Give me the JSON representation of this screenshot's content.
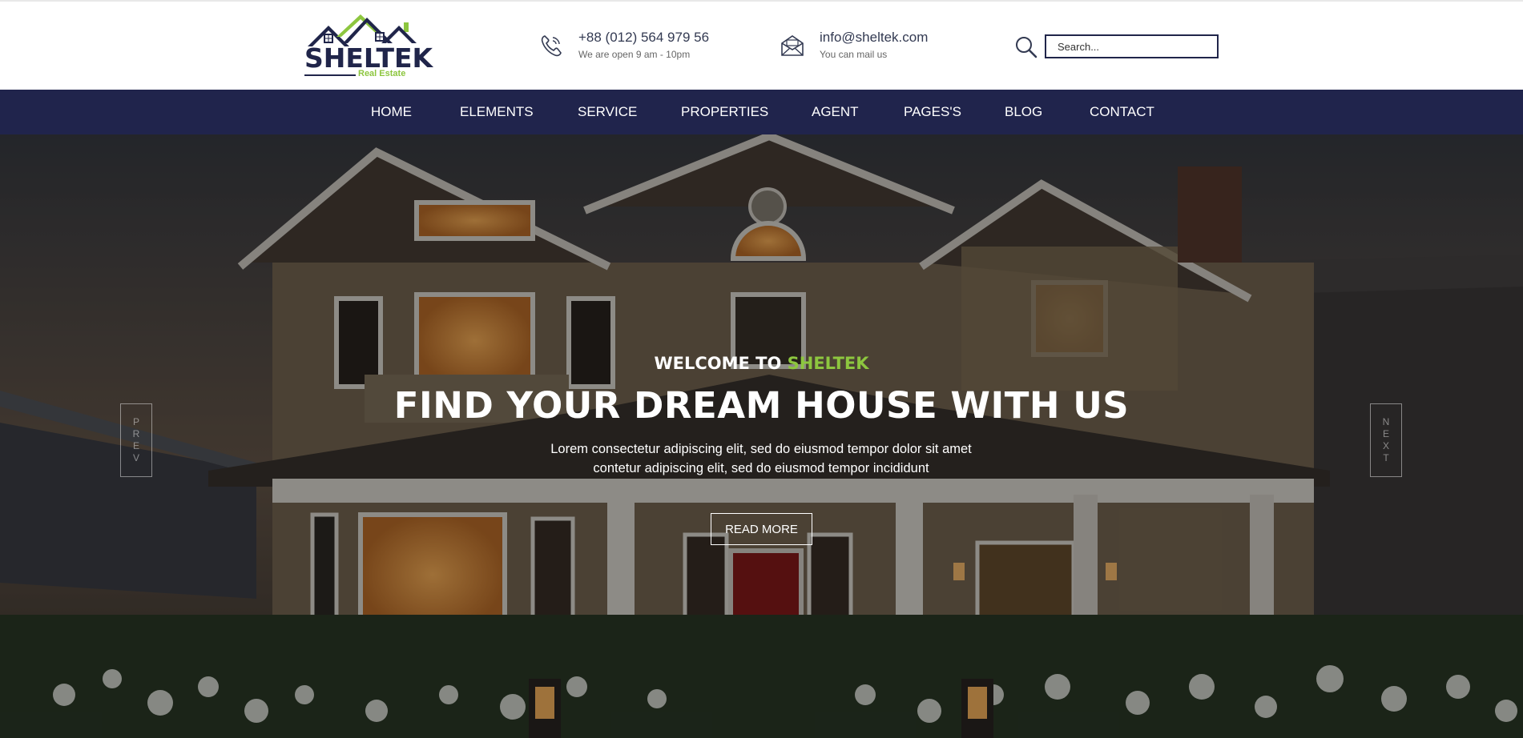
{
  "logo": {
    "text": "SHELTEK",
    "subtitle": "Real Estate"
  },
  "contact": {
    "phone": {
      "icon": "phone-icon",
      "main": "+88 (012) 564 979 56",
      "sub": "We are open 9 am - 10pm"
    },
    "email": {
      "icon": "envelope-icon",
      "main": "info@sheltek.com",
      "sub": "You can mail us"
    }
  },
  "search": {
    "icon": "search-icon",
    "placeholder": "Search..."
  },
  "nav": {
    "items": [
      "HOME",
      "ELEMENTS",
      "SERVICE",
      "PROPERTIES",
      "AGENT",
      "PAGES'S",
      "BLOG",
      "CONTACT"
    ]
  },
  "hero": {
    "welcome_prefix": "WELCOME TO",
    "welcome_brand": "SHELTEK",
    "headline": "FIND YOUR DREAM HOUSE WITH US",
    "lead_line1": "Lorem consectetur adipiscing elit, sed do eiusmod tempor dolor sit amet",
    "lead_line2": "contetur adipiscing elit, sed do eiusmod tempor incididunt",
    "button": "READ MORE",
    "prev_letters": [
      "P",
      "R",
      "E",
      "V"
    ],
    "next_letters": [
      "N",
      "E",
      "X",
      "T"
    ]
  },
  "colors": {
    "brand_navy": "#20244c",
    "accent_green": "#8dc63f",
    "white": "#ffffff"
  }
}
